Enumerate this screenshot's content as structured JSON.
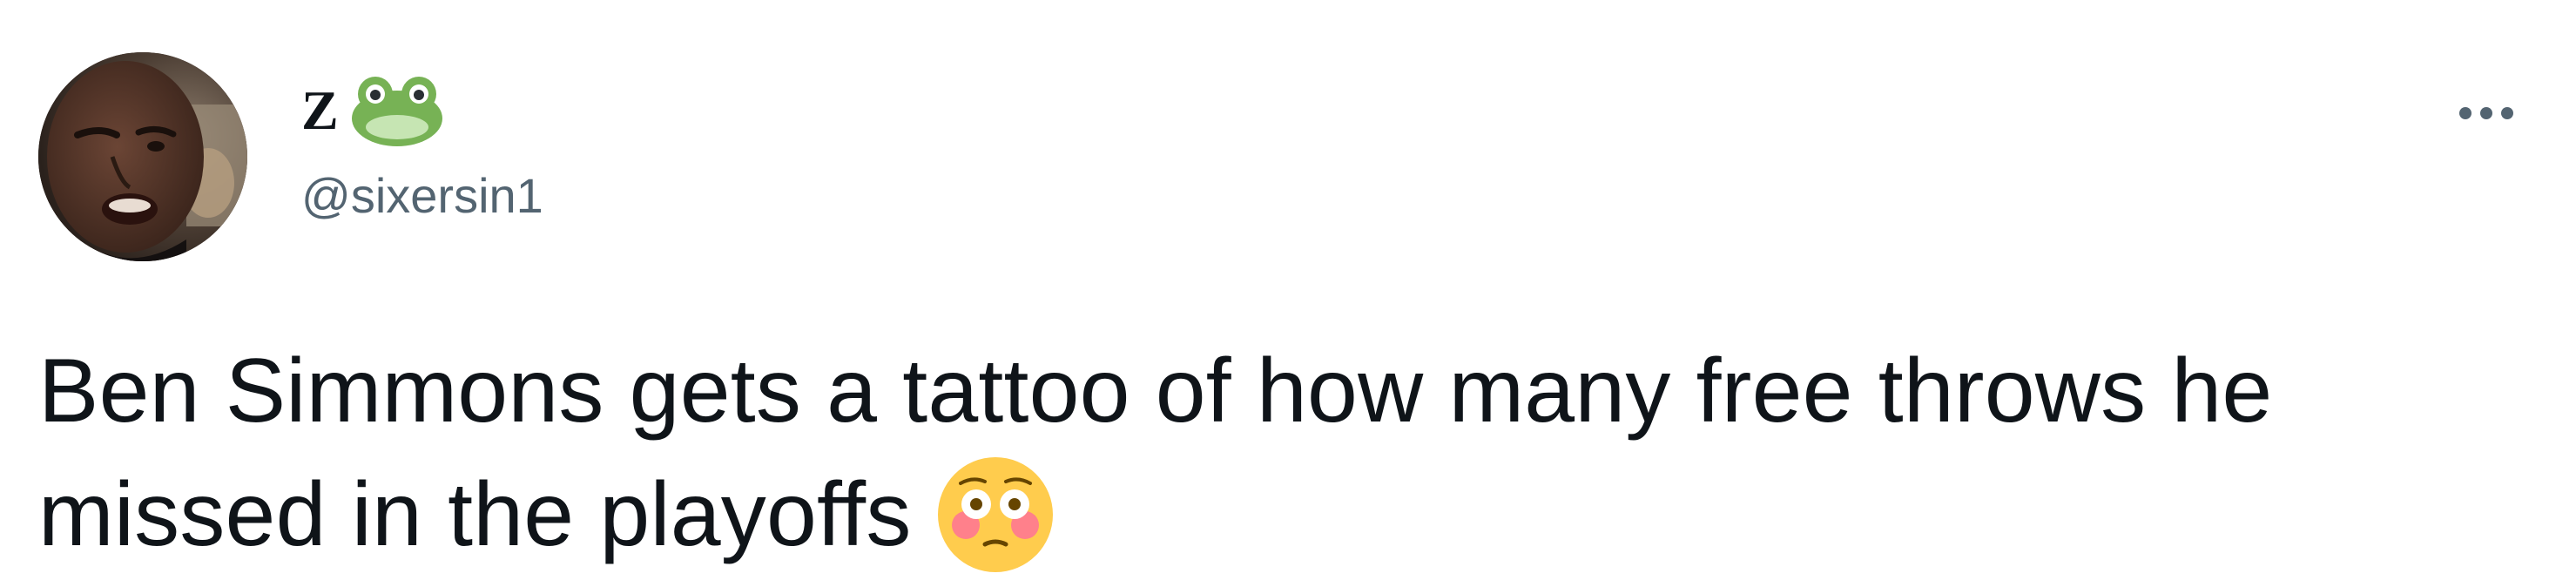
{
  "tweet": {
    "author": {
      "display_name": "Z",
      "display_name_emoji": "frog-face",
      "handle": "@sixersin1",
      "avatar": "profile-photo"
    },
    "more_menu_icon": "more-dots-icon",
    "text_line_1": "Ben Simmons gets a tattoo of how many free throws he",
    "text_line_2": "missed in the playoffs",
    "text_emoji": "flushed-face"
  },
  "colors": {
    "background": "#ffffff",
    "primary_text": "#0f1419",
    "secondary_text": "#536471"
  }
}
